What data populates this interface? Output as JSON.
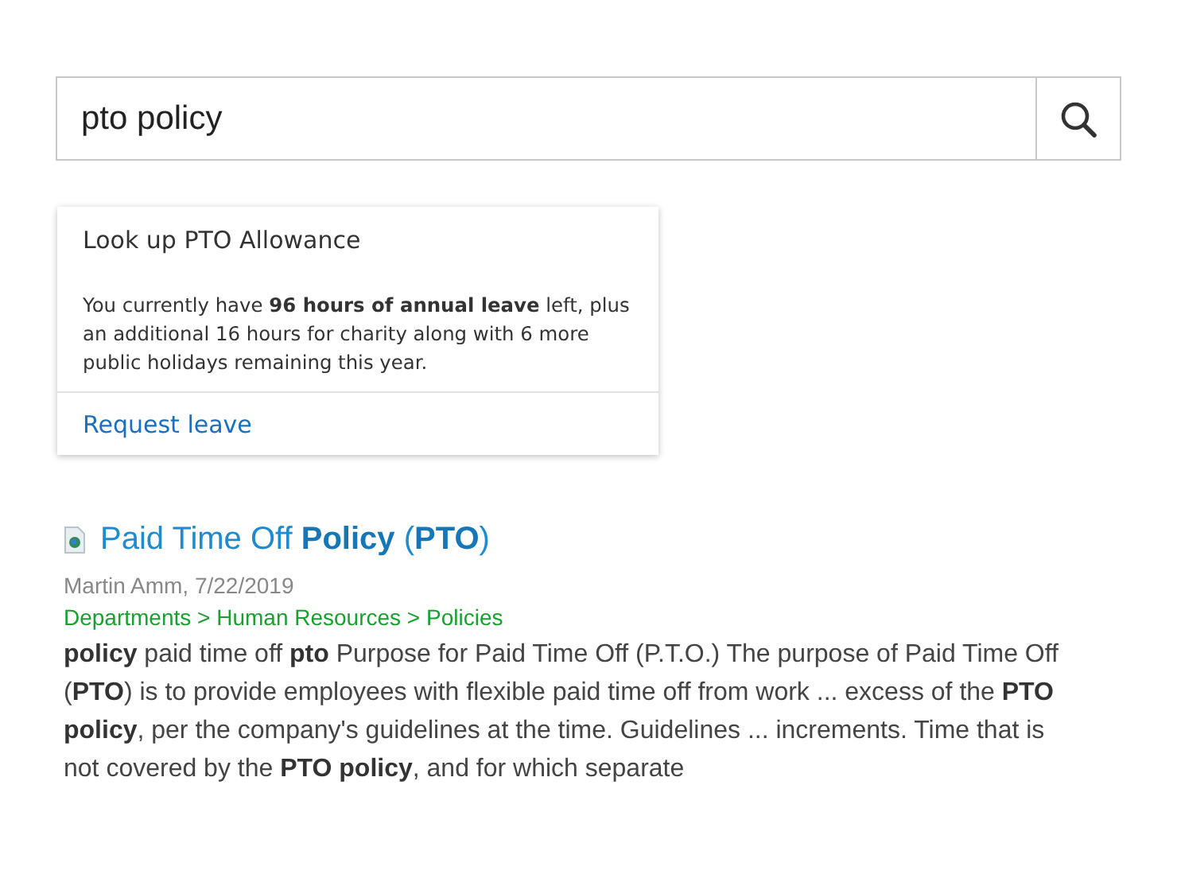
{
  "search": {
    "value": "pto policy"
  },
  "answer_card": {
    "title": "Look up PTO Allowance",
    "text": "You currently have **96 hours of annual leave** left, plus an additional 16 hours for charity along with 6 more public holidays remaining this year.",
    "link": "Request leave"
  },
  "results": [
    {
      "title": "Paid Time Off **Policy** (**PTO**)",
      "meta": "Martin Amm, 7/22/2019",
      "breadcrumb": "Departments > Human Resources > Policies",
      "snippet": "**policy** paid time off **pto** Purpose for Paid Time Off (P.T.O.) The purpose of Paid Time Off (**PTO**) is to provide employees with flexible paid time off from work ... excess of the **PTO policy**, per the company's guidelines at the time. Guidelines ... increments. Time that is not covered by the **PTO policy**, and for which separate"
    }
  ]
}
